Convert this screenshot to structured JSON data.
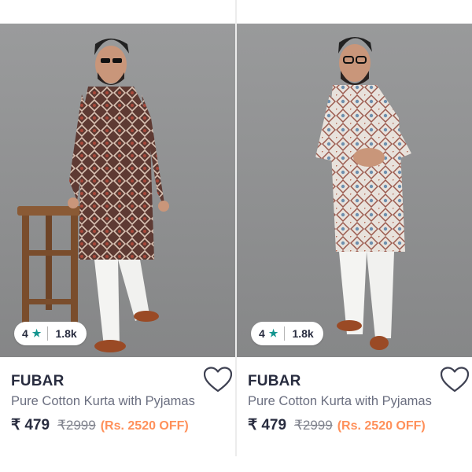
{
  "products": [
    {
      "rating": "4",
      "star_icon": "star-icon",
      "rating_count": "1.8k",
      "brand": "FUBAR",
      "title": "Pure Cotton Kurta with Pyjamas",
      "price": "₹ 479",
      "mrp": "₹2999",
      "discount": "(Rs. 2520 OFF)",
      "wishlist_icon": "heart-outline-icon"
    },
    {
      "rating": "4",
      "star_icon": "star-icon",
      "rating_count": "1.8k",
      "brand": "FUBAR",
      "title": "Pure Cotton Kurta with Pyjamas",
      "price": "₹ 479",
      "mrp": "₹2999",
      "discount": "(Rs. 2520 OFF)",
      "wishlist_icon": "heart-outline-icon"
    }
  ],
  "colors": {
    "rating_star": "#14958f",
    "discount": "#ff905a",
    "brand_text": "#282c3f"
  }
}
